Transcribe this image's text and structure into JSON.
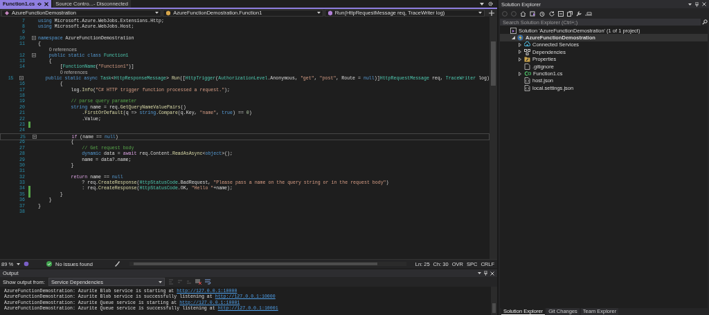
{
  "tabs": [
    {
      "label": "Function1.cs",
      "selected": true
    },
    {
      "label": "Source Contro...- Disconnected",
      "selected": false
    }
  ],
  "nav": [
    "AzureFunctionDemostration",
    "AzureFunctionDemostration.Function1",
    "Run(HttpRequestMessage req, TraceWriter log)"
  ],
  "code": {
    "lines": [
      {
        "number": "7",
        "tokens": [
          {
            "text": "using",
            "kind": "kw"
          },
          {
            "text": " Microsoft.Azure.WebJobs.Extensions.Http;",
            "kind": "plain"
          }
        ]
      },
      {
        "number": "8",
        "tokens": [
          {
            "text": "using",
            "kind": "kw"
          },
          {
            "text": " Microsoft.Azure.WebJobs.Host;",
            "kind": "plain"
          }
        ]
      },
      {
        "number": "9"
      },
      {
        "number": "10",
        "fold": true,
        "tokens": [
          {
            "text": "namespace",
            "kind": "kw"
          },
          {
            "text": " AzureFunctionDemostration",
            "kind": "plain"
          }
        ]
      },
      {
        "number": "11",
        "tokens": [
          {
            "text": "{",
            "kind": "plain"
          }
        ]
      },
      {
        "number": "12",
        "fold": true,
        "references": "0 references",
        "tokens": [
          {
            "text": "    public static class ",
            "kind": "kw"
          },
          {
            "text": "Function1",
            "kind": "type"
          }
        ]
      },
      {
        "number": "13",
        "tokens": [
          {
            "text": "    {",
            "kind": "plain"
          }
        ]
      },
      {
        "number": "14",
        "tokens": [
          {
            "text": "        [",
            "kind": "plain"
          },
          {
            "text": "FunctionName",
            "kind": "type"
          },
          {
            "text": "(",
            "kind": "plain"
          },
          {
            "text": "\"Function1\"",
            "kind": "str"
          },
          {
            "text": ")]",
            "kind": "plain"
          }
        ]
      },
      {
        "number": "15",
        "fold": true,
        "references": "0 references",
        "tokens": [
          {
            "text": "        public static async ",
            "kind": "kw"
          },
          {
            "text": "Task",
            "kind": "type"
          },
          {
            "text": "<",
            "kind": "plain"
          },
          {
            "text": "HttpResponseMessage",
            "kind": "type"
          },
          {
            "text": "> ",
            "kind": "plain"
          },
          {
            "text": "Run",
            "kind": "method"
          },
          {
            "text": "([",
            "kind": "plain"
          },
          {
            "text": "HttpTrigger",
            "kind": "type"
          },
          {
            "text": "(",
            "kind": "plain"
          },
          {
            "text": "AuthorizationLevel",
            "kind": "type"
          },
          {
            "text": ".Anonymous, ",
            "kind": "plain"
          },
          {
            "text": "\"get\"",
            "kind": "str"
          },
          {
            "text": ", ",
            "kind": "plain"
          },
          {
            "text": "\"post\"",
            "kind": "str"
          },
          {
            "text": ", Route = ",
            "kind": "plain"
          },
          {
            "text": "null",
            "kind": "kw"
          },
          {
            "text": ")]",
            "kind": "plain"
          },
          {
            "text": "HttpRequestMessage",
            "kind": "type"
          },
          {
            "text": " req, ",
            "kind": "plain"
          },
          {
            "text": "TraceWriter",
            "kind": "type"
          },
          {
            "text": " log)",
            "kind": "plain"
          }
        ]
      },
      {
        "number": "16",
        "tokens": [
          {
            "text": "        {",
            "kind": "plain"
          }
        ]
      },
      {
        "number": "17",
        "tokens": [
          {
            "text": "            log.",
            "kind": "plain"
          },
          {
            "text": "Info",
            "kind": "method"
          },
          {
            "text": "(",
            "kind": "plain"
          },
          {
            "text": "\"C# HTTP trigger function processed a request.\"",
            "kind": "str"
          },
          {
            "text": ");",
            "kind": "plain"
          }
        ]
      },
      {
        "number": "18"
      },
      {
        "number": "19",
        "tokens": [
          {
            "text": "            // parse query parameter",
            "kind": "cmt"
          }
        ]
      },
      {
        "number": "20",
        "tokens": [
          {
            "text": "            string",
            "kind": "kw"
          },
          {
            "text": " name = req.",
            "kind": "plain"
          },
          {
            "text": "GetQueryNameValuePairs",
            "kind": "method"
          },
          {
            "text": "()",
            "kind": "plain"
          }
        ]
      },
      {
        "number": "21",
        "tokens": [
          {
            "text": "                .",
            "kind": "plain"
          },
          {
            "text": "FirstOrDefault",
            "kind": "method"
          },
          {
            "text": "(q => ",
            "kind": "plain"
          },
          {
            "text": "string",
            "kind": "kw"
          },
          {
            "text": ".",
            "kind": "plain"
          },
          {
            "text": "Compare",
            "kind": "method"
          },
          {
            "text": "(q.Key, ",
            "kind": "plain"
          },
          {
            "text": "\"name\"",
            "kind": "str"
          },
          {
            "text": ", ",
            "kind": "plain"
          },
          {
            "text": "true",
            "kind": "kw"
          },
          {
            "text": ") == ",
            "kind": "plain"
          },
          {
            "text": "0",
            "kind": "num"
          },
          {
            "text": ")",
            "kind": "plain"
          }
        ]
      },
      {
        "number": "22",
        "tokens": [
          {
            "text": "                .Value;",
            "kind": "plain"
          }
        ]
      },
      {
        "number": "23",
        "changed": true
      },
      {
        "number": "24"
      },
      {
        "number": "25",
        "fold": true,
        "current": true,
        "tokens": [
          {
            "text": "            if",
            "kind": "ctl"
          },
          {
            "text": " (name == ",
            "kind": "plain"
          },
          {
            "text": "null",
            "kind": "kw"
          },
          {
            "text": ")",
            "kind": "plain"
          }
        ]
      },
      {
        "number": "26",
        "tokens": [
          {
            "text": "            {",
            "kind": "plain"
          }
        ]
      },
      {
        "number": "27",
        "tokens": [
          {
            "text": "                // Get request body",
            "kind": "cmt"
          }
        ]
      },
      {
        "number": "28",
        "tokens": [
          {
            "text": "                dynamic",
            "kind": "kw"
          },
          {
            "text": " data = ",
            "kind": "plain"
          },
          {
            "text": "await",
            "kind": "ctl"
          },
          {
            "text": " req.Content.",
            "kind": "plain"
          },
          {
            "text": "ReadAsAsync",
            "kind": "method"
          },
          {
            "text": "<",
            "kind": "plain"
          },
          {
            "text": "object",
            "kind": "kw"
          },
          {
            "text": ">();",
            "kind": "plain"
          }
        ]
      },
      {
        "number": "29",
        "tokens": [
          {
            "text": "                name = data?.name;",
            "kind": "plain"
          }
        ]
      },
      {
        "number": "30",
        "tokens": [
          {
            "text": "            }",
            "kind": "plain"
          }
        ]
      },
      {
        "number": "31"
      },
      {
        "number": "32",
        "tokens": [
          {
            "text": "            return",
            "kind": "ctl"
          },
          {
            "text": " name == ",
            "kind": "plain"
          },
          {
            "text": "null",
            "kind": "kw"
          }
        ]
      },
      {
        "number": "33",
        "tokens": [
          {
            "text": "                ? req.",
            "kind": "plain"
          },
          {
            "text": "CreateResponse",
            "kind": "method"
          },
          {
            "text": "(",
            "kind": "plain"
          },
          {
            "text": "HttpStatusCode",
            "kind": "type"
          },
          {
            "text": ".BadRequest, ",
            "kind": "plain"
          },
          {
            "text": "\"Please pass a name on the query string or in the request body\"",
            "kind": "str"
          },
          {
            "text": ")",
            "kind": "plain"
          }
        ]
      },
      {
        "number": "34",
        "changed": true,
        "tokens": [
          {
            "text": "                : req.",
            "kind": "plain"
          },
          {
            "text": "CreateResponse",
            "kind": "method"
          },
          {
            "text": "(",
            "kind": "plain"
          },
          {
            "text": "HttpStatusCode",
            "kind": "type"
          },
          {
            "text": ".OK, ",
            "kind": "plain"
          },
          {
            "text": "\"Hello \"",
            "kind": "str"
          },
          {
            "text": "+name);",
            "kind": "plain"
          }
        ]
      },
      {
        "number": "35",
        "changed": true,
        "tokens": [
          {
            "text": "        }",
            "kind": "plain"
          }
        ]
      },
      {
        "number": "36",
        "tokens": [
          {
            "text": "    }",
            "kind": "plain"
          }
        ]
      },
      {
        "number": "37",
        "tokens": [
          {
            "text": "}",
            "kind": "plain"
          }
        ]
      },
      {
        "number": "38"
      }
    ]
  },
  "status_bar": {
    "zoom": "89 %",
    "issues": "No issues found",
    "line": "Ln: 25",
    "column": "Ch: 30",
    "mode": "OVR",
    "whitespace": "SPC",
    "line_endings": "CRLF"
  },
  "output": {
    "title": "Output",
    "source_label": "Show output from:",
    "source": "Service Dependencies",
    "lines": [
      {
        "text": "AzureFunctionDemostration: Azurite Blob service is starting at ",
        "link": "http://127.0.0.1:10000"
      },
      {
        "text": "AzureFunctionDemostration: Azurite Blob service is successfully listening at ",
        "link": "http://127.0.0.1:10000"
      },
      {
        "text": "AzureFunctionDemostration: Azurite Queue service is starting at ",
        "link": "http://127.0.0.1:10001"
      },
      {
        "text": "AzureFunctionDemostration: Azurite Queue service is successfully listening at ",
        "link": "http://127.0.0.1:10001"
      }
    ]
  },
  "solution_explorer": {
    "title": "Solution Explorer",
    "search": {
      "placeholder": "Search Solution Explorer (Ctrl+;)"
    },
    "tree": [
      {
        "label": "Solution 'AzureFunctionDemostration' (1 of 1 project)",
        "kind": "solution",
        "selected": false,
        "children": [
          {
            "label": "AzureFunctionDemostration",
            "kind": "project",
            "selected": true,
            "expanded": true,
            "children": [
              {
                "label": "Connected Services",
                "kind": "connected",
                "selected": false,
                "expanded": false
              },
              {
                "label": "Dependencies",
                "kind": "dependencies",
                "selected": false,
                "expanded": false
              },
              {
                "label": "Properties",
                "kind": "properties",
                "selected": false,
                "expanded": false
              },
              {
                "label": ".gitignore",
                "kind": "file",
                "selected": false
              },
              {
                "label": "Function1.cs",
                "kind": "csharp",
                "selected": false,
                "expanded": false
              },
              {
                "label": "host.json",
                "kind": "json",
                "selected": false
              },
              {
                "label": "local.settings.json",
                "kind": "json",
                "selected": false
              }
            ]
          }
        ]
      }
    ],
    "tabs": [
      {
        "label": "Solution Explorer",
        "selected": true
      },
      {
        "label": "Git Changes",
        "selected": false
      },
      {
        "label": "Team Explorer",
        "selected": false
      }
    ]
  }
}
